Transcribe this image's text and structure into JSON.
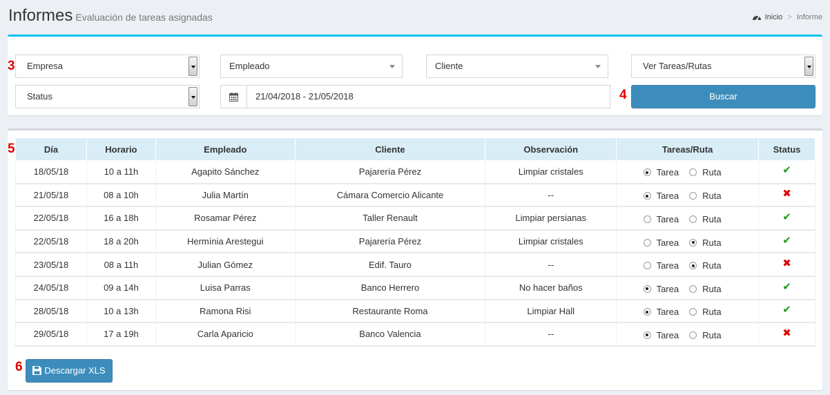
{
  "header": {
    "title": "Informes",
    "subtitle": "Evaluación de tareas asignadas",
    "breadcrumb": {
      "home": "Inicio",
      "separator": ">",
      "current": "Informe"
    }
  },
  "callouts": {
    "filters": "3",
    "search": "4",
    "table": "5",
    "download": "6"
  },
  "filters": {
    "empresa": "Empresa",
    "empleado": "Empleado",
    "cliente": "Cliente",
    "ver": "Ver Tareas/Rutas",
    "status": "Status",
    "date_range": "21/04/2018 - 21/05/2018",
    "search_button": "Buscar"
  },
  "table": {
    "headers": [
      "Día",
      "Horario",
      "Empleado",
      "Cliente",
      "Observación",
      "Tareas/Ruta",
      "Status"
    ],
    "radio_labels": {
      "tarea": "Tarea",
      "ruta": "Ruta"
    },
    "rows": [
      {
        "dia": "18/05/18",
        "horario": "10 a 11h",
        "empleado": "Agapito Sánchez",
        "cliente": "Pajarería Pérez",
        "observacion": "Limpiar cristales",
        "selected": "tarea",
        "status": "ok"
      },
      {
        "dia": "21/05/18",
        "horario": "08 a 10h",
        "empleado": "Julia Martín",
        "cliente": "Cámara Comercio Alicante",
        "observacion": "--",
        "selected": "tarea",
        "status": "fail"
      },
      {
        "dia": "22/05/18",
        "horario": "16 a 18h",
        "empleado": "Rosamar Pérez",
        "cliente": "Taller Renault",
        "observacion": "Limpiar persianas",
        "selected": "none",
        "status": "ok"
      },
      {
        "dia": "22/05/18",
        "horario": "18 a 20h",
        "empleado": "Hermínia Arestegui",
        "cliente": "Pajarería Pérez",
        "observacion": "Limpiar cristales",
        "selected": "ruta",
        "status": "ok"
      },
      {
        "dia": "23/05/18",
        "horario": "08 a 11h",
        "empleado": "Julian Gómez",
        "cliente": "Edif. Tauro",
        "observacion": "--",
        "selected": "ruta",
        "status": "fail"
      },
      {
        "dia": "24/05/18",
        "horario": "09 a 14h",
        "empleado": "Luisa Parras",
        "cliente": "Banco Herrero",
        "observacion": "No hacer baños",
        "selected": "tarea",
        "status": "ok"
      },
      {
        "dia": "28/05/18",
        "horario": "10 a 13h",
        "empleado": "Ramona Risi",
        "cliente": "Restaurante Roma",
        "observacion": "Limpiar Hall",
        "selected": "tarea",
        "status": "ok"
      },
      {
        "dia": "29/05/18",
        "horario": "17 a 19h",
        "empleado": "Carla Aparicio",
        "cliente": "Banco Valencia",
        "observacion": "--",
        "selected": "tarea",
        "status": "fail"
      }
    ]
  },
  "download_button": "Descargar XLS",
  "icons": {
    "dashboard": "dashboard-icon",
    "calendar": "calendar-icon",
    "save": "save-icon",
    "ok": "check-icon",
    "fail": "cross-icon"
  },
  "status_symbols": {
    "ok": "✔",
    "fail": "✖"
  },
  "colors": {
    "accent": "#3c8dbc",
    "box_top": "#00c0ef",
    "ok": "#1a9a1a",
    "fail": "#e00000",
    "table_header": "#d9edf7"
  }
}
